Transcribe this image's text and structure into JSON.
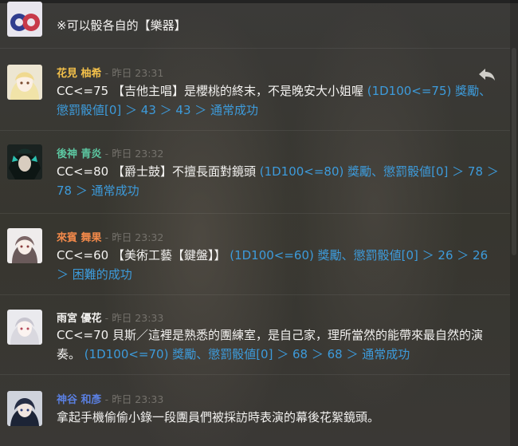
{
  "messages": [
    {
      "id": "m0",
      "name": "",
      "name_color": "#c9c6c0",
      "time": "",
      "body": "※可以骰各自的【樂器】",
      "roll": ""
    },
    {
      "id": "m1",
      "name": "花見 柚希",
      "name_color": "#f3c04a",
      "time": "昨日 23:31",
      "body": "CC<=75 【吉他主唱】是櫻桃的終末，不是晚安大小姐喔 ",
      "roll": "(1D100<=75) 獎勵、懲罰骰値[0] ＞ 43 ＞ 43 ＞ 通常成功"
    },
    {
      "id": "m2",
      "name": "後神 青炎",
      "name_color": "#5cc7a1",
      "time": "昨日 23:32",
      "body": "CC<=80 【爵士鼓】不擅長面對鏡頭 ",
      "roll": "(1D100<=80) 獎勵、懲罰骰値[0] ＞ 78 ＞ 78 ＞ 通常成功"
    },
    {
      "id": "m3",
      "name": "來賓 舞果",
      "name_color": "#f2894a",
      "time": "昨日 23:32",
      "body": "CC<=60 【美術工藝【鍵盤】】 ",
      "roll": "(1D100<=60) 獎勵、懲罰骰値[0] ＞ 26 ＞ 26 ＞ 困難的成功"
    },
    {
      "id": "m4",
      "name": "雨宮 優花",
      "name_color": "#f2f1ef",
      "time": "昨日 23:33",
      "body": "CC<=70 貝斯／這裡是熟悉的團練室，是自己家，理所當然的能帶來最自然的演奏。 ",
      "roll": "(1D100<=70) 獎勵、懲罰骰値[0] ＞ 68 ＞ 68 ＞ 通常成功"
    },
    {
      "id": "m5",
      "name": "神谷 和彥",
      "name_color": "#5a7fe0",
      "time": "昨日 23:33",
      "body": "拿起手機偷偷小錄一段團員們被採訪時表演的幕後花絮鏡頭。",
      "roll": ""
    }
  ],
  "separator": "-",
  "icons": {
    "reply": "reply-icon"
  }
}
